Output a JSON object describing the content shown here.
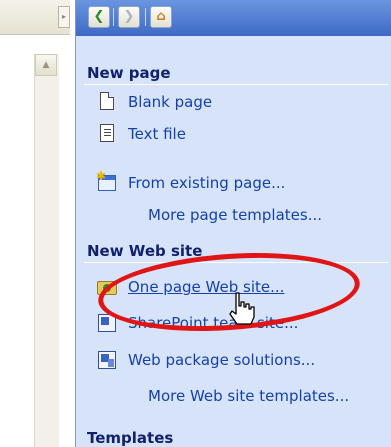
{
  "nav": {
    "back_icon": "back-arrow-icon",
    "forward_icon": "forward-arrow-icon",
    "home_icon": "home-icon"
  },
  "sections": {
    "new_page": {
      "title": "New page",
      "items": [
        {
          "label": "Blank page",
          "icon": "blank-page-icon"
        },
        {
          "label": "Text file",
          "icon": "text-file-icon"
        },
        {
          "label": "From existing page...",
          "icon": "existing-page-icon"
        },
        {
          "label": "More page templates..."
        }
      ]
    },
    "new_web_site": {
      "title": "New Web site",
      "items": [
        {
          "label": "One page Web site...",
          "icon": "web-folder-icon"
        },
        {
          "label": "SharePoint team site...",
          "icon": "sharepoint-site-icon"
        },
        {
          "label": "Web package solutions...",
          "icon": "web-package-icon"
        },
        {
          "label": "More Web site templates..."
        }
      ]
    },
    "templates": {
      "title": "Templates"
    }
  },
  "colors": {
    "pane_background": "#d6e3f8",
    "header_gradient_top": "#6a95e0",
    "link_color": "#1642a8",
    "title_color": "#11216b",
    "annotation_red": "#e01515"
  }
}
